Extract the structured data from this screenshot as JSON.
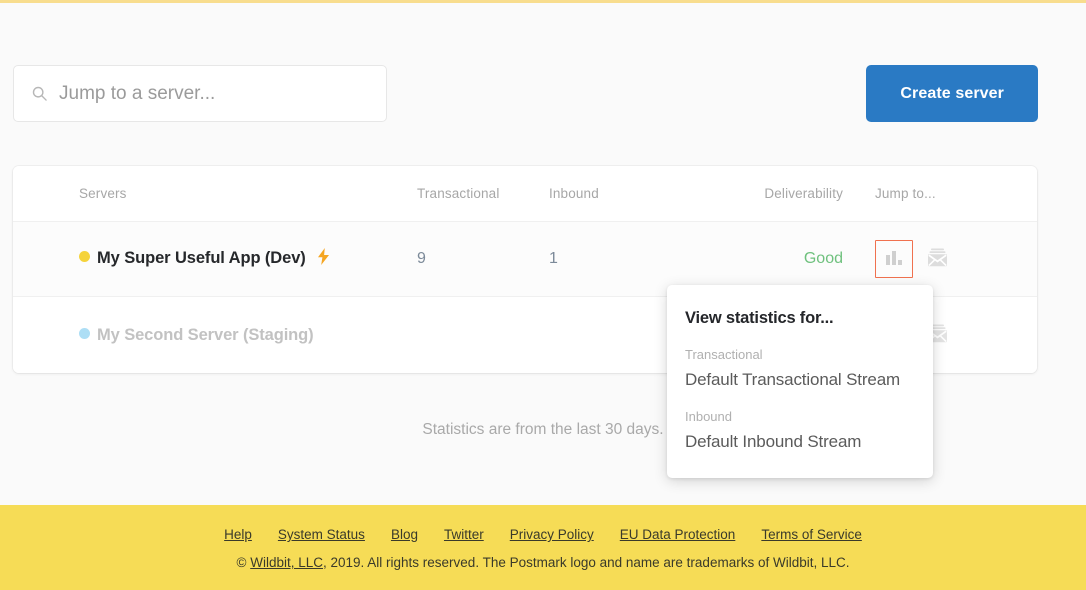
{
  "theme": {
    "page_bg": "#fafafa",
    "top_rule": "#f8dd8e",
    "primary_button": "#2a7ac4",
    "footer_bg": "#f6dc56",
    "highlight_border": "#f0714f",
    "status_good": "#6fc17e"
  },
  "search": {
    "placeholder": "Jump to a server...",
    "value": "",
    "icon": "search-icon"
  },
  "toolbar": {
    "create_label": "Create server"
  },
  "table": {
    "columns": [
      {
        "key": "servers",
        "label": "Servers"
      },
      {
        "key": "transactional",
        "label": "Transactional"
      },
      {
        "key": "inbound",
        "label": "Inbound"
      },
      {
        "key": "deliverability",
        "label": "Deliverability"
      },
      {
        "key": "jumpto",
        "label": "Jump to..."
      }
    ],
    "rows": [
      {
        "name": "My Super Useful App (Dev)",
        "dot_color": "#f5d33b",
        "bolt": true,
        "bolt_color": "#f5a623",
        "transactional": "9",
        "inbound": "1",
        "deliverability": "Good",
        "active": true,
        "chart_icon": "bar-chart-icon",
        "mail_icon": "mail-stack-icon",
        "chart_highlighted": true
      },
      {
        "name": "My Second Server (Staging)",
        "dot_color": "#addef5",
        "bolt": false,
        "bolt_color": "",
        "transactional": "",
        "inbound": "",
        "deliverability": "",
        "active": false,
        "chart_icon": "",
        "mail_icon": "mail-stack-icon",
        "chart_highlighted": false
      }
    ]
  },
  "stats_note": "Statistics are from the last 30 days.",
  "popup": {
    "title": "View statistics for...",
    "groups": [
      {
        "label": "Transactional",
        "items": [
          "Default Transactional Stream"
        ]
      },
      {
        "label": "Inbound",
        "items": [
          "Default Inbound Stream"
        ]
      }
    ]
  },
  "footer": {
    "links": [
      "Help",
      "System Status",
      "Blog",
      "Twitter",
      "Privacy Policy",
      "EU Data Protection",
      "Terms of Service"
    ],
    "copyright_prefix": "© ",
    "copyright_link": "Wildbit, LLC",
    "copyright_suffix": ", 2019. All rights reserved. The Postmark logo and name are trademarks of Wildbit, LLC."
  }
}
